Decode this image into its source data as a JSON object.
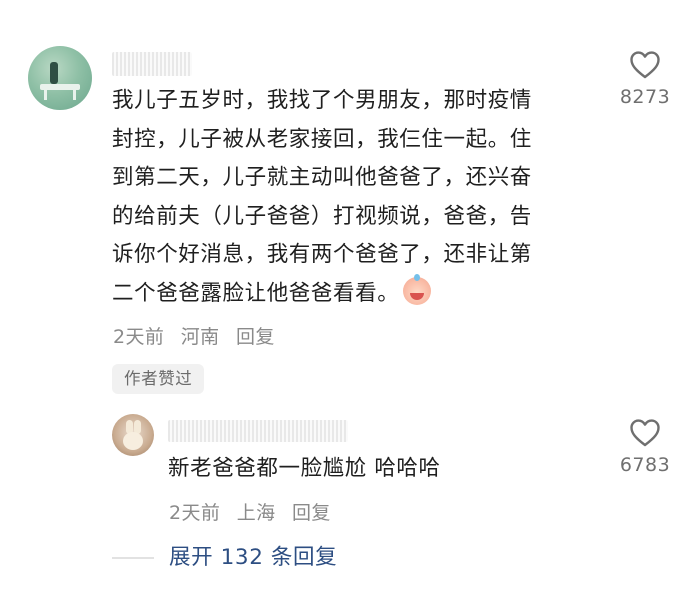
{
  "comment": {
    "text_lines": [
      "我儿子五岁时，我找了个男朋友，那时疫情",
      "封控，儿子被从老家接回，我仨住一起。住",
      "到第二天，儿子就主动叫他爸爸了，还兴奋",
      "的给前夫（儿子爸爸）打视频说，爸爸，告",
      "诉你个好消息，我有两个爸爸了，还非让第",
      "二个爸爸露脸让他爸爸看看。"
    ],
    "emoji": "laughing-crying-emoji",
    "time": "2天前",
    "location": "河南",
    "reply_label": "回复",
    "badge": "作者赞过",
    "like_count": "8273"
  },
  "reply": {
    "text": "新老爸爸都一脸尴尬 哈哈哈",
    "time": "2天前",
    "location": "上海",
    "reply_label": "回复",
    "like_count": "6783"
  },
  "expand": {
    "label": "展开 132 条回复"
  },
  "colors": {
    "link": "#2d4e82",
    "meta": "#8a8a8a",
    "heart_outline": "#6f6f6f"
  },
  "icons": {
    "like": "heart-outline-icon"
  }
}
